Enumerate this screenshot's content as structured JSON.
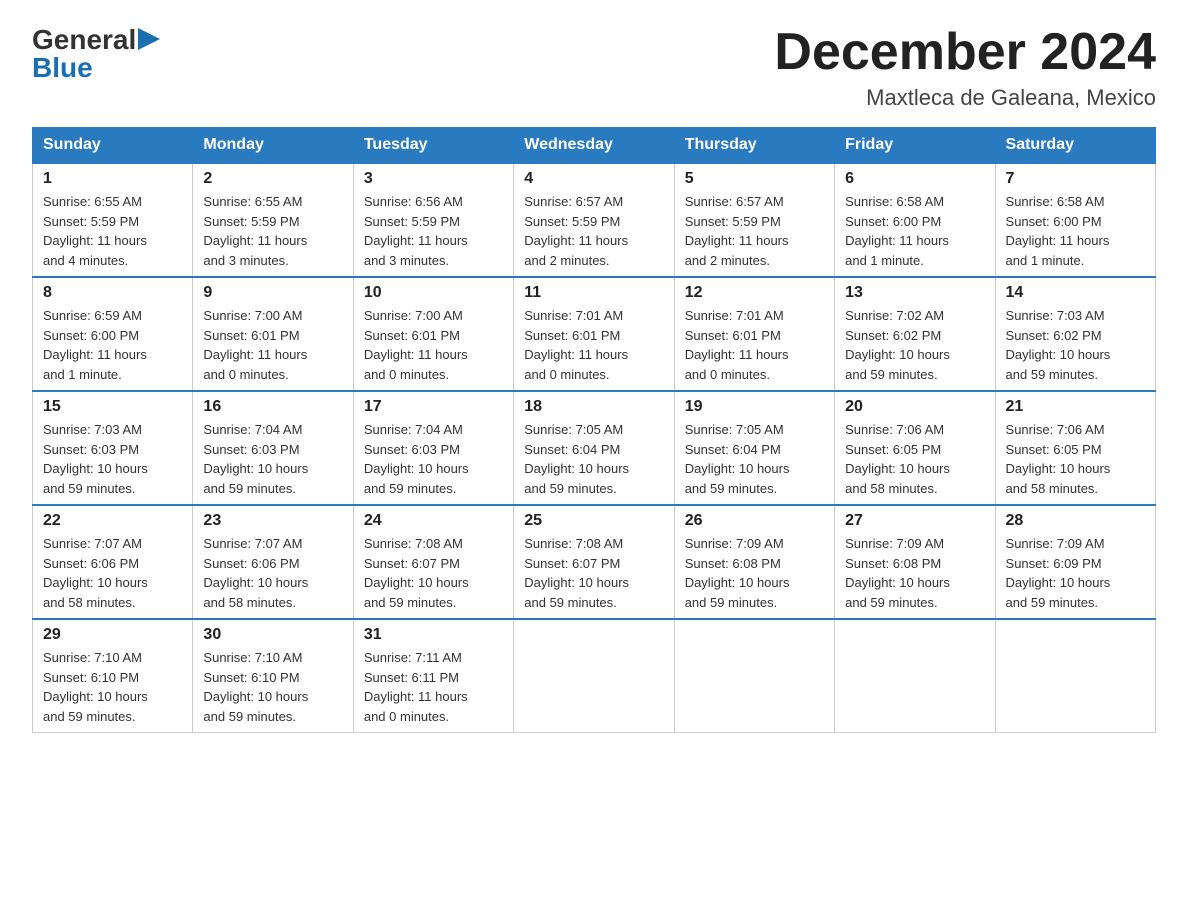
{
  "logo": {
    "general": "General",
    "blue": "Blue",
    "triangle": "▶"
  },
  "title": "December 2024",
  "subtitle": "Maxtleca de Galeana, Mexico",
  "days_of_week": [
    "Sunday",
    "Monday",
    "Tuesday",
    "Wednesday",
    "Thursday",
    "Friday",
    "Saturday"
  ],
  "weeks": [
    [
      {
        "day": "1",
        "sunrise": "6:55 AM",
        "sunset": "5:59 PM",
        "daylight": "11 hours and 4 minutes."
      },
      {
        "day": "2",
        "sunrise": "6:55 AM",
        "sunset": "5:59 PM",
        "daylight": "11 hours and 3 minutes."
      },
      {
        "day": "3",
        "sunrise": "6:56 AM",
        "sunset": "5:59 PM",
        "daylight": "11 hours and 3 minutes."
      },
      {
        "day": "4",
        "sunrise": "6:57 AM",
        "sunset": "5:59 PM",
        "daylight": "11 hours and 2 minutes."
      },
      {
        "day": "5",
        "sunrise": "6:57 AM",
        "sunset": "5:59 PM",
        "daylight": "11 hours and 2 minutes."
      },
      {
        "day": "6",
        "sunrise": "6:58 AM",
        "sunset": "6:00 PM",
        "daylight": "11 hours and 1 minute."
      },
      {
        "day": "7",
        "sunrise": "6:58 AM",
        "sunset": "6:00 PM",
        "daylight": "11 hours and 1 minute."
      }
    ],
    [
      {
        "day": "8",
        "sunrise": "6:59 AM",
        "sunset": "6:00 PM",
        "daylight": "11 hours and 1 minute."
      },
      {
        "day": "9",
        "sunrise": "7:00 AM",
        "sunset": "6:01 PM",
        "daylight": "11 hours and 0 minutes."
      },
      {
        "day": "10",
        "sunrise": "7:00 AM",
        "sunset": "6:01 PM",
        "daylight": "11 hours and 0 minutes."
      },
      {
        "day": "11",
        "sunrise": "7:01 AM",
        "sunset": "6:01 PM",
        "daylight": "11 hours and 0 minutes."
      },
      {
        "day": "12",
        "sunrise": "7:01 AM",
        "sunset": "6:01 PM",
        "daylight": "11 hours and 0 minutes."
      },
      {
        "day": "13",
        "sunrise": "7:02 AM",
        "sunset": "6:02 PM",
        "daylight": "10 hours and 59 minutes."
      },
      {
        "day": "14",
        "sunrise": "7:03 AM",
        "sunset": "6:02 PM",
        "daylight": "10 hours and 59 minutes."
      }
    ],
    [
      {
        "day": "15",
        "sunrise": "7:03 AM",
        "sunset": "6:03 PM",
        "daylight": "10 hours and 59 minutes."
      },
      {
        "day": "16",
        "sunrise": "7:04 AM",
        "sunset": "6:03 PM",
        "daylight": "10 hours and 59 minutes."
      },
      {
        "day": "17",
        "sunrise": "7:04 AM",
        "sunset": "6:03 PM",
        "daylight": "10 hours and 59 minutes."
      },
      {
        "day": "18",
        "sunrise": "7:05 AM",
        "sunset": "6:04 PM",
        "daylight": "10 hours and 59 minutes."
      },
      {
        "day": "19",
        "sunrise": "7:05 AM",
        "sunset": "6:04 PM",
        "daylight": "10 hours and 59 minutes."
      },
      {
        "day": "20",
        "sunrise": "7:06 AM",
        "sunset": "6:05 PM",
        "daylight": "10 hours and 58 minutes."
      },
      {
        "day": "21",
        "sunrise": "7:06 AM",
        "sunset": "6:05 PM",
        "daylight": "10 hours and 58 minutes."
      }
    ],
    [
      {
        "day": "22",
        "sunrise": "7:07 AM",
        "sunset": "6:06 PM",
        "daylight": "10 hours and 58 minutes."
      },
      {
        "day": "23",
        "sunrise": "7:07 AM",
        "sunset": "6:06 PM",
        "daylight": "10 hours and 58 minutes."
      },
      {
        "day": "24",
        "sunrise": "7:08 AM",
        "sunset": "6:07 PM",
        "daylight": "10 hours and 59 minutes."
      },
      {
        "day": "25",
        "sunrise": "7:08 AM",
        "sunset": "6:07 PM",
        "daylight": "10 hours and 59 minutes."
      },
      {
        "day": "26",
        "sunrise": "7:09 AM",
        "sunset": "6:08 PM",
        "daylight": "10 hours and 59 minutes."
      },
      {
        "day": "27",
        "sunrise": "7:09 AM",
        "sunset": "6:08 PM",
        "daylight": "10 hours and 59 minutes."
      },
      {
        "day": "28",
        "sunrise": "7:09 AM",
        "sunset": "6:09 PM",
        "daylight": "10 hours and 59 minutes."
      }
    ],
    [
      {
        "day": "29",
        "sunrise": "7:10 AM",
        "sunset": "6:10 PM",
        "daylight": "10 hours and 59 minutes."
      },
      {
        "day": "30",
        "sunrise": "7:10 AM",
        "sunset": "6:10 PM",
        "daylight": "10 hours and 59 minutes."
      },
      {
        "day": "31",
        "sunrise": "7:11 AM",
        "sunset": "6:11 PM",
        "daylight": "11 hours and 0 minutes."
      },
      null,
      null,
      null,
      null
    ]
  ],
  "labels": {
    "sunrise": "Sunrise:",
    "sunset": "Sunset:",
    "daylight": "Daylight:"
  }
}
